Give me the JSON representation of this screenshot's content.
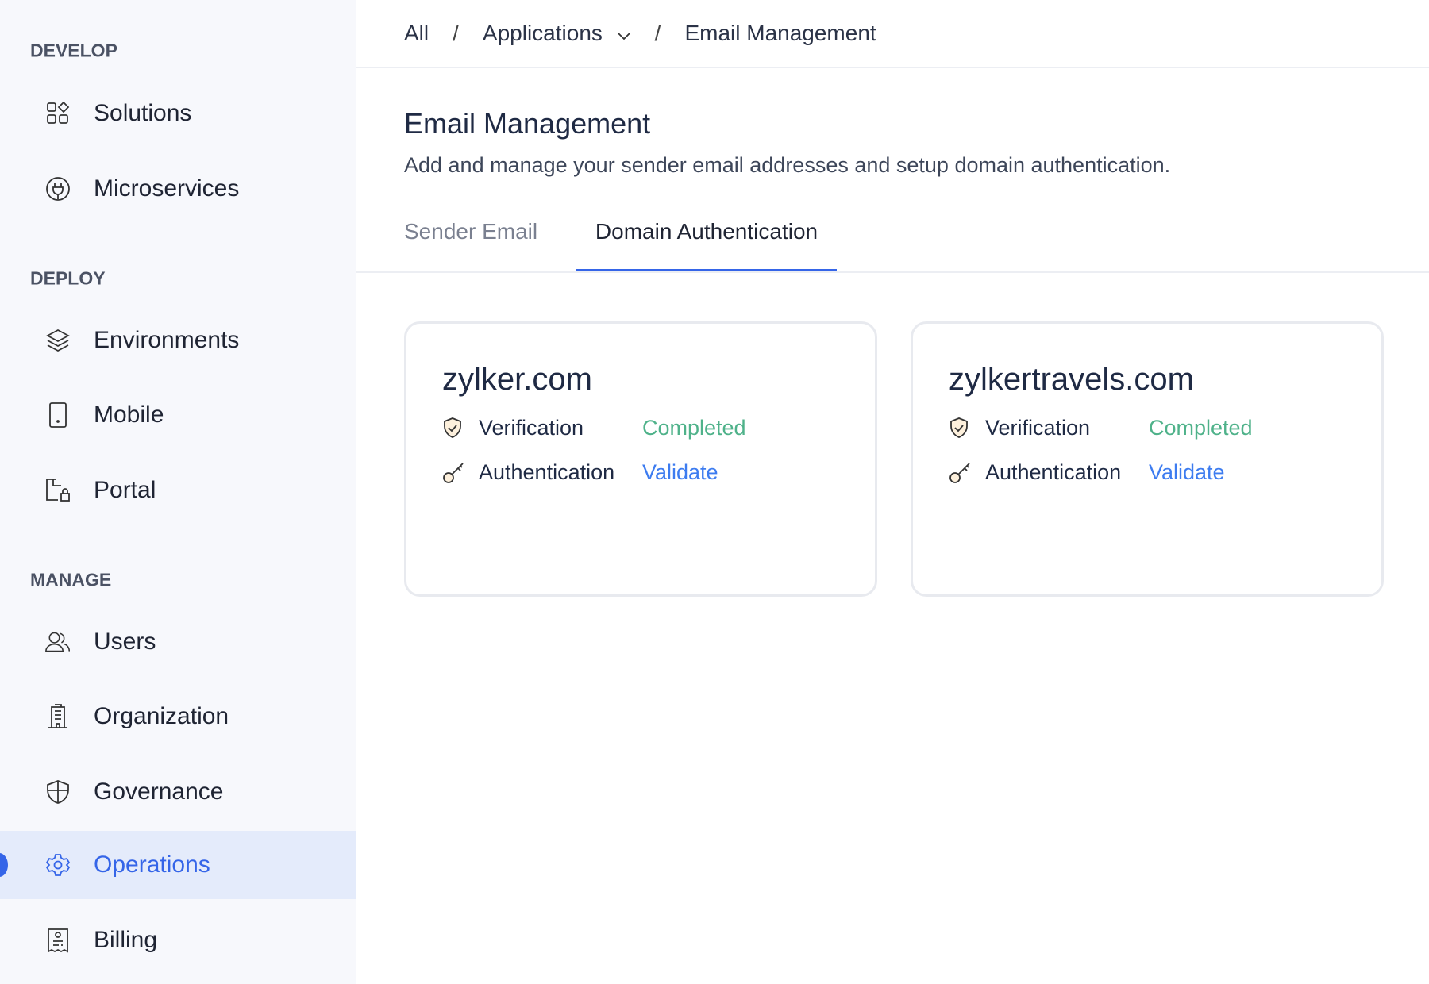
{
  "sidebar": {
    "sections": [
      {
        "title": "DEVELOP",
        "items": [
          {
            "label": "Solutions",
            "icon": "grid-icon"
          },
          {
            "label": "Microservices",
            "icon": "plug-icon"
          }
        ]
      },
      {
        "title": "DEPLOY",
        "items": [
          {
            "label": "Environments",
            "icon": "layers-icon"
          },
          {
            "label": "Mobile",
            "icon": "mobile-icon"
          },
          {
            "label": "Portal",
            "icon": "portal-icon"
          }
        ]
      },
      {
        "title": "MANAGE",
        "items": [
          {
            "label": "Users",
            "icon": "users-icon"
          },
          {
            "label": "Organization",
            "icon": "building-icon"
          },
          {
            "label": "Governance",
            "icon": "shield-icon"
          },
          {
            "label": "Operations",
            "icon": "gear-icon",
            "active": true
          },
          {
            "label": "Billing",
            "icon": "receipt-icon"
          }
        ]
      }
    ]
  },
  "breadcrumb": {
    "all": "All",
    "applications": "Applications",
    "current": "Email Management",
    "sep": "/"
  },
  "page": {
    "title": "Email Management",
    "subtitle": "Add and manage your sender email addresses and setup domain authentication."
  },
  "tabs": [
    {
      "label": "Sender Email"
    },
    {
      "label": "Domain Authentication",
      "active": true
    }
  ],
  "domains": [
    {
      "name": "zylker.com",
      "verification_label": "Verification",
      "verification_status": "Completed",
      "auth_label": "Authentication",
      "auth_action": "Validate"
    },
    {
      "name": "zylkertravels.com",
      "verification_label": "Verification",
      "verification_status": "Completed",
      "auth_label": "Authentication",
      "auth_action": "Validate"
    }
  ],
  "colors": {
    "accent": "#3565e8",
    "success": "#4fb28a",
    "link": "#3d7cf0"
  }
}
